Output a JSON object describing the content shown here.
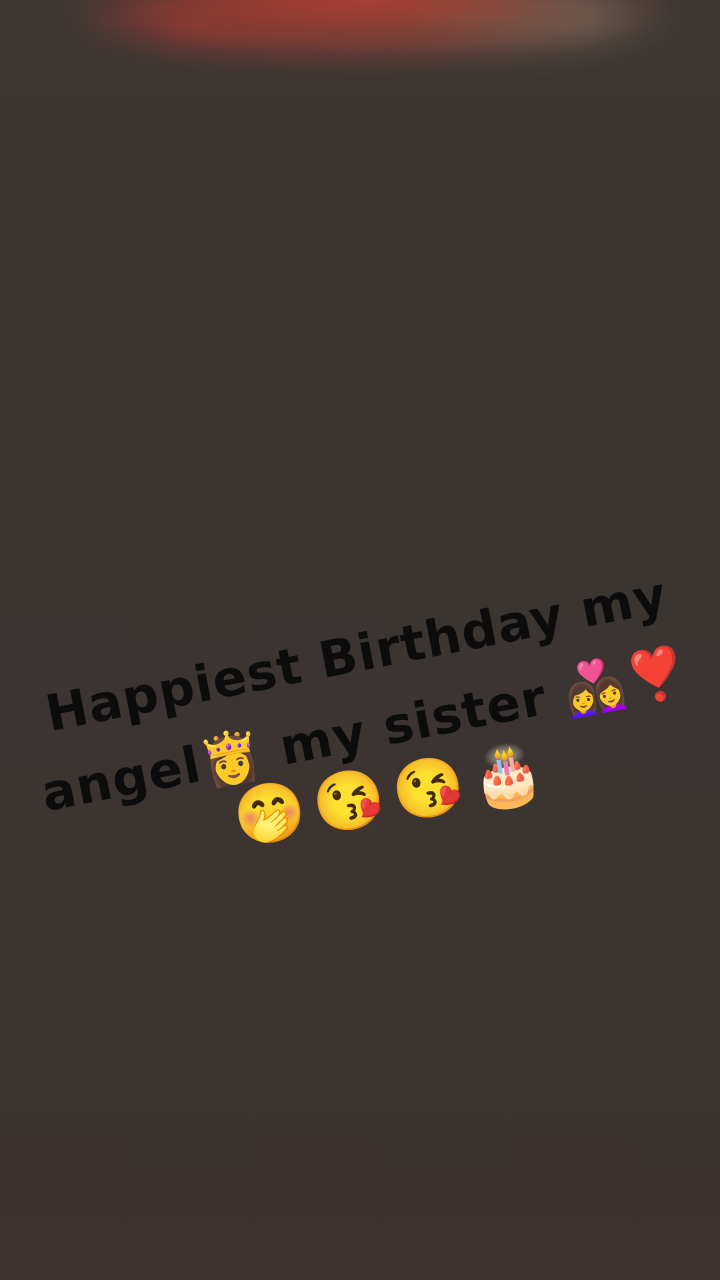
{
  "caption": {
    "line1": "Happiest Birthday my",
    "line2_text_a": "angel",
    "line2_emoji_a": "👸",
    "line2_text_b": "my sister",
    "line2_emoji_b": "👩‍❤️‍👩",
    "line2_emoji_c": "❣️",
    "line3_emojis": [
      "🤭",
      "😘",
      "😘",
      "🎂"
    ]
  },
  "colors": {
    "background": "#3b3431",
    "text": "#0d0c0c",
    "top_glow": "#b9372d"
  }
}
